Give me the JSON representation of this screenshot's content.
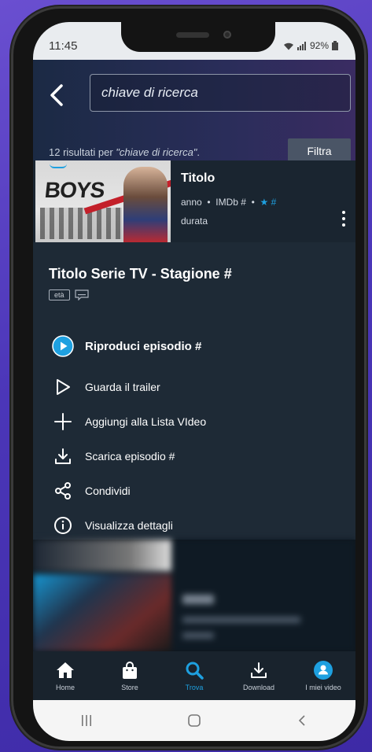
{
  "status_bar": {
    "time": "11:45",
    "battery": "92%"
  },
  "search": {
    "query": "chiave di ricerca"
  },
  "results": {
    "prefix": "12 risultati per ",
    "query_quoted": "\"chiave di ricerca\"",
    "suffix": "."
  },
  "filter_label": "Filtra",
  "result_card": {
    "thumbnail_text": "BOYS",
    "title": "Titolo",
    "meta_year": "anno",
    "meta_imdb": "IMDb #",
    "meta_stars": "★ #",
    "duration": "durata"
  },
  "panel": {
    "series_title": "Titolo Serie TV - Stagione #",
    "age_badge": "età",
    "actions": [
      {
        "label": "Riproduci episodio #",
        "icon": "play-circle-icon"
      },
      {
        "label": "Guarda il trailer",
        "icon": "play-outline-icon"
      },
      {
        "label": "Aggiungi alla Lista VIdeo",
        "icon": "plus-icon"
      },
      {
        "label": "Scarica episodio #",
        "icon": "download-icon"
      },
      {
        "label": "Condividi",
        "icon": "share-icon"
      },
      {
        "label": "Visualizza dettagli",
        "icon": "info-icon"
      }
    ]
  },
  "tabs": [
    {
      "label": "Home",
      "icon": "home-icon"
    },
    {
      "label": "Store",
      "icon": "store-bag-icon"
    },
    {
      "label": "Trova",
      "icon": "search-icon",
      "active": true
    },
    {
      "label": "Download",
      "icon": "download-icon"
    },
    {
      "label": "I miei video",
      "icon": "profile-icon"
    }
  ],
  "colors": {
    "accent": "#1ea0e0",
    "panel": "#1e2a36",
    "background": "#0f171e"
  }
}
